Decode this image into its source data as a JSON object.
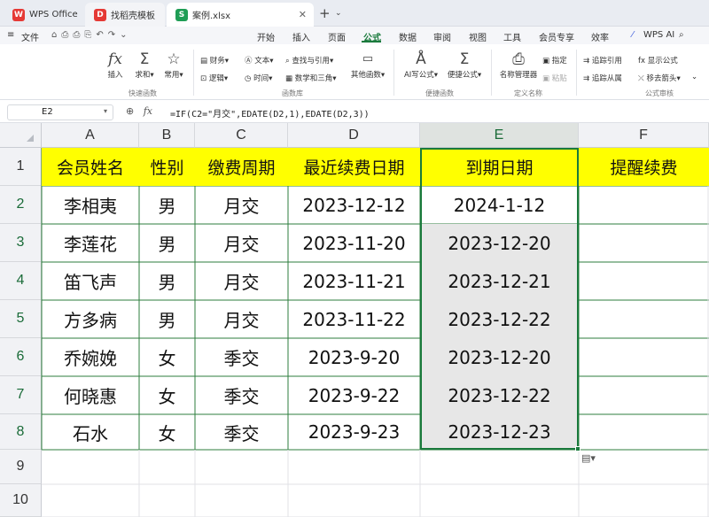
{
  "tabs": [
    {
      "label": "WPS Office",
      "icon": "wps-logo-icon"
    },
    {
      "label": "找稻壳模板",
      "icon": "daoke-icon"
    },
    {
      "label": "案例.xlsx",
      "icon": "spreadsheet-s-icon"
    }
  ],
  "menu": {
    "file": "文件",
    "items": [
      "开始",
      "插入",
      "页面",
      "公式",
      "数据",
      "审阅",
      "视图",
      "工具",
      "会员专享",
      "效率"
    ],
    "active": "公式",
    "ai": "WPS AI"
  },
  "ribbon": {
    "insert_fn": "插入",
    "sum": "求和",
    "common": "常用",
    "finance": "财务",
    "text": "文本",
    "lookup": "查找与引用",
    "logic": "逻辑",
    "time": "时间",
    "math": "数学和三角",
    "other": "其他函数",
    "ai_formula": "AI写公式",
    "quick_formula": "便捷公式",
    "name_mgr": "名称管理器",
    "define": "指定",
    "paste": "粘贴",
    "trace_prec": "追踪引用",
    "show_formula": "显示公式",
    "trace_dep": "追踪从属",
    "remove_arrow": "移去箭头",
    "groups": {
      "quick": "快速函数",
      "lib": "函数库",
      "easy": "便捷函数",
      "names": "定义名称",
      "audit": "公式审核"
    }
  },
  "formula_bar": {
    "name_box": "E2",
    "formula": "=IF(C2=\"月交\",EDATE(D2,1),EDATE(D2,3))"
  },
  "sheet": {
    "columns": [
      "A",
      "B",
      "C",
      "D",
      "E",
      "F"
    ],
    "rows": [
      "1",
      "2",
      "3",
      "4",
      "5",
      "6",
      "7",
      "8",
      "9",
      "10"
    ],
    "selected_column": "E",
    "selected_cell": "E2",
    "header": [
      "会员姓名",
      "性别",
      "缴费周期",
      "最近续费日期",
      "到期日期",
      "提醒续费"
    ],
    "data": [
      [
        "李相夷",
        "男",
        "月交",
        "2023-12-12",
        "2024-1-12",
        ""
      ],
      [
        "李莲花",
        "男",
        "月交",
        "2023-11-20",
        "2023-12-20",
        ""
      ],
      [
        "笛飞声",
        "男",
        "月交",
        "2023-11-21",
        "2023-12-21",
        ""
      ],
      [
        "方多病",
        "男",
        "月交",
        "2023-11-22",
        "2023-12-22",
        ""
      ],
      [
        "乔婉娩",
        "女",
        "季交",
        "2023-9-20",
        "2023-12-20",
        ""
      ],
      [
        "何晓惠",
        "女",
        "季交",
        "2023-9-22",
        "2023-12-22",
        ""
      ],
      [
        "石水",
        "女",
        "季交",
        "2023-9-23",
        "2023-12-23",
        ""
      ]
    ]
  },
  "colors": {
    "header_fill": "#ffff00",
    "selected_fill": "#e7e7e7",
    "accent": "#1a7a3c"
  }
}
